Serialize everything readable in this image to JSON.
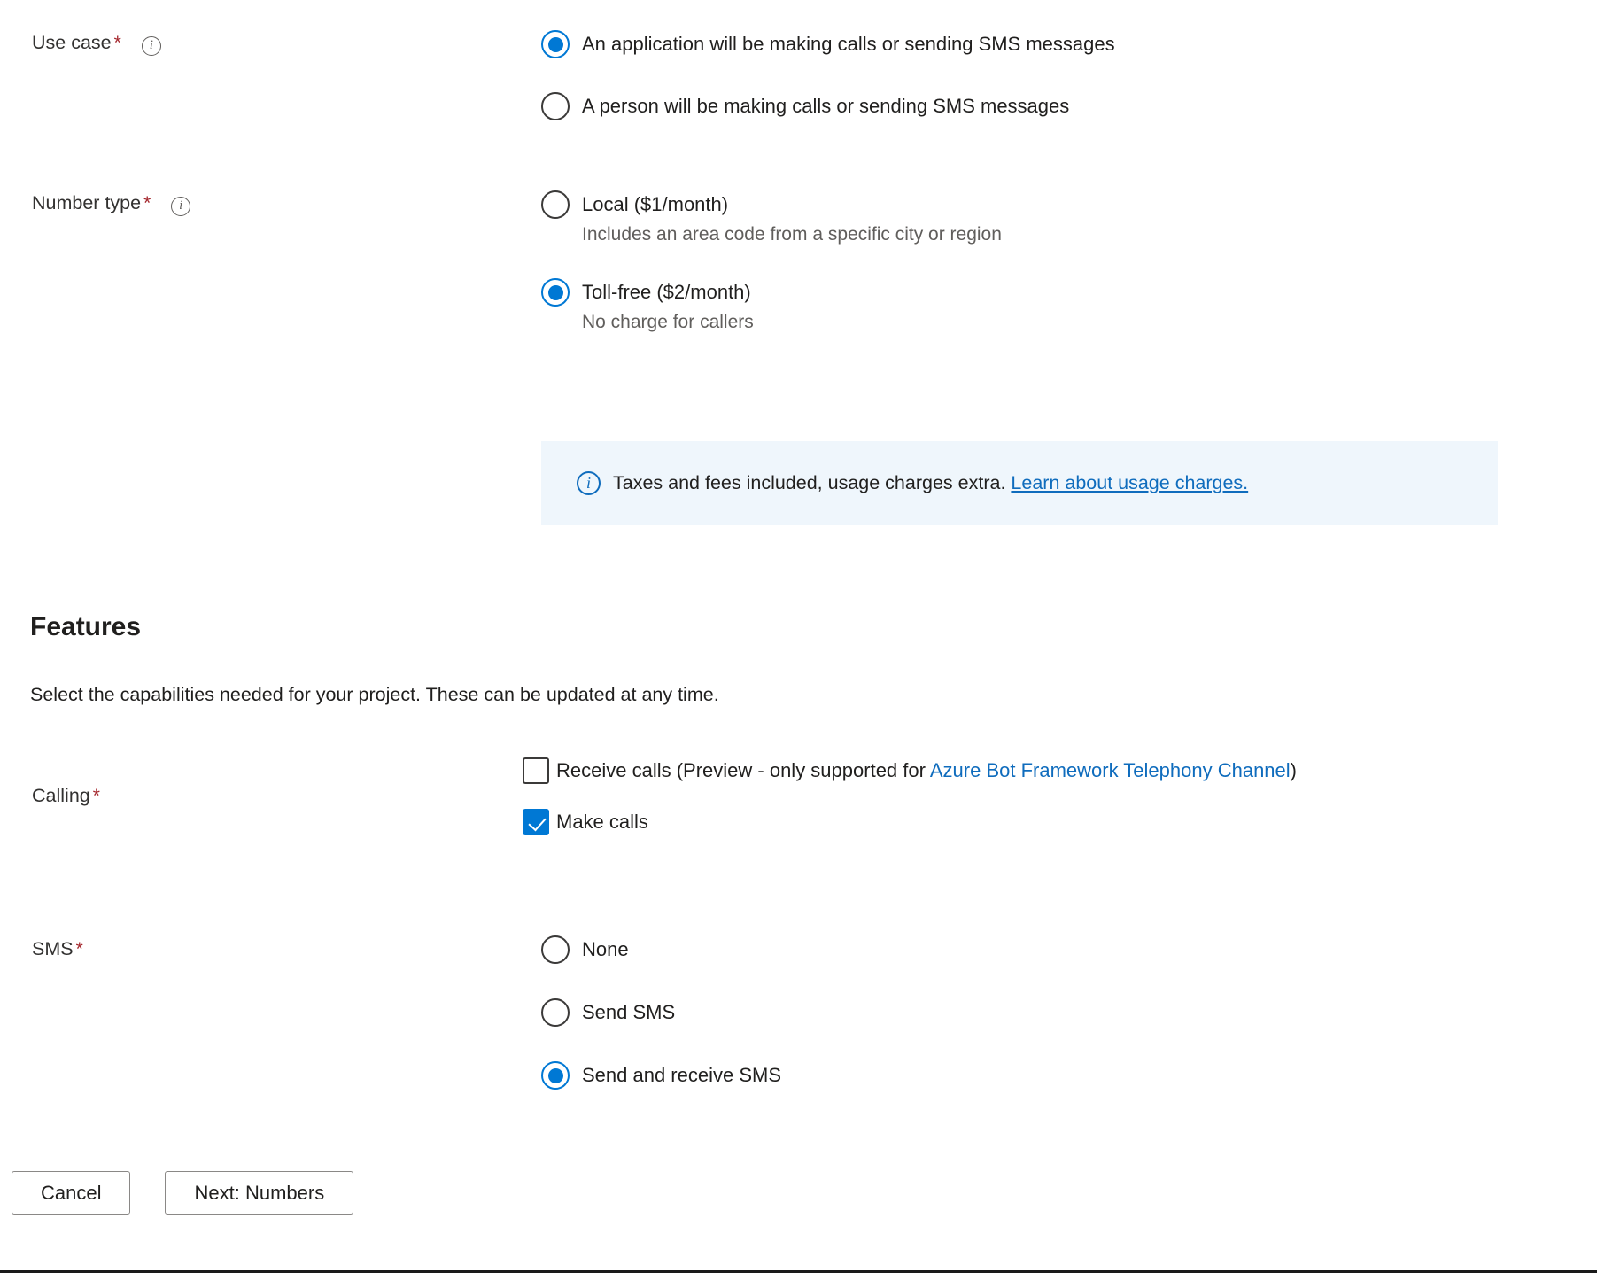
{
  "form": {
    "use_case": {
      "label": "Use case",
      "required_marker": "*",
      "info_icon": "info-icon",
      "options": [
        {
          "label": "An application will be making calls or sending SMS messages",
          "selected": true
        },
        {
          "label": "A person will be making calls or sending SMS messages",
          "selected": false
        }
      ]
    },
    "number_type": {
      "label": "Number type",
      "required_marker": "*",
      "info_icon": "info-icon",
      "options": [
        {
          "label": "Local ($1/month)",
          "sublabel": "Includes an area code from a specific city or region",
          "selected": false
        },
        {
          "label": "Toll-free ($2/month)",
          "sublabel": "No charge for callers",
          "selected": true
        }
      ]
    },
    "pricing_banner": {
      "icon": "info-circle-icon",
      "text": "Taxes and fees included, usage charges extra.",
      "link_text": "Learn about usage charges.",
      "background": "#eff6fc",
      "accent": "#0f6cbd"
    }
  },
  "features": {
    "title": "Features",
    "description": "Select the capabilities needed for your project. These can be updated at any time.",
    "calling": {
      "label": "Calling",
      "required_marker": "*",
      "options": [
        {
          "prefix": "Receive calls (Preview - only supported for ",
          "link_text": "Azure Bot Framework Telephony Channel",
          "suffix": ")",
          "checked": false
        },
        {
          "prefix": "Make calls",
          "link_text": "",
          "suffix": "",
          "checked": true
        }
      ]
    },
    "sms": {
      "label": "SMS",
      "required_marker": "*",
      "options": [
        {
          "label": "None",
          "selected": false
        },
        {
          "label": "Send SMS",
          "selected": false
        },
        {
          "label": "Send and receive SMS",
          "selected": true
        }
      ]
    }
  },
  "footer": {
    "cancel_label": "Cancel",
    "next_label": "Next: Numbers"
  },
  "colors": {
    "accent": "#0078d4",
    "link": "#0f6cbd",
    "required": "#a4262c",
    "banner_bg": "#eff6fc"
  }
}
